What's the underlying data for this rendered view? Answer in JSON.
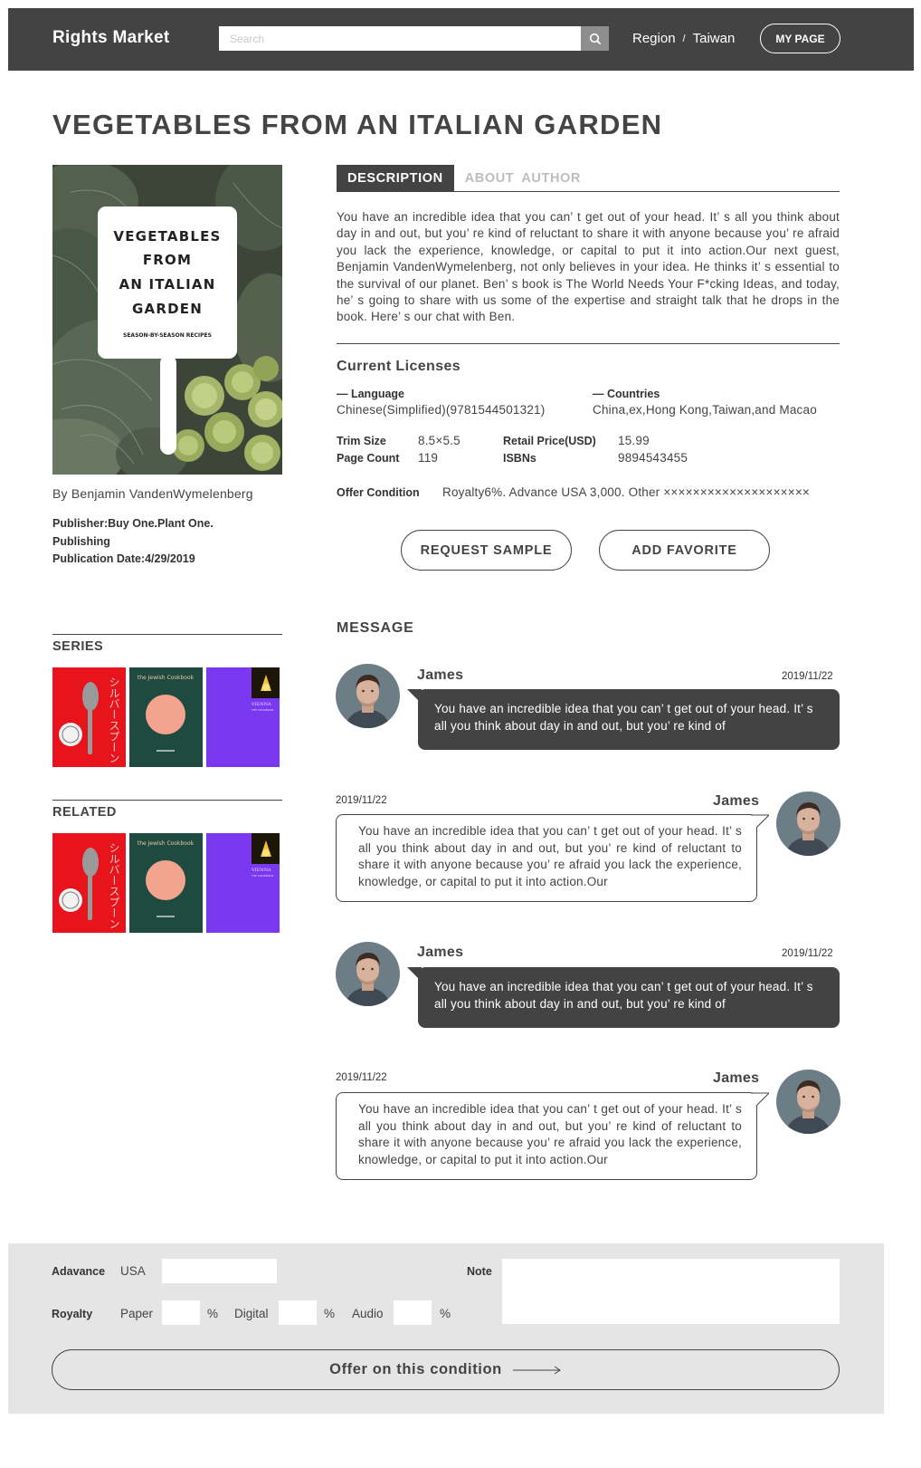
{
  "header": {
    "logo": "Rights Market",
    "search_placeholder": "Search",
    "region_label": "Region",
    "region_separator": "/",
    "region_value": "Taiwan",
    "mypage_label": "MY PAGE"
  },
  "book": {
    "title": "VEGETABLES FROM AN ITALIAN GARDEN",
    "cover": {
      "lines": [
        "VEGETABLES",
        "FROM",
        "AN ITALIAN",
        "GARDEN"
      ],
      "subtitle": "SEASON-BY-SEASON RECIPES"
    },
    "author": "By Benjamin VandenWymelenberg",
    "publisher_line1": "Publisher:Buy One.Plant One.",
    "publisher_line2": "Publishing",
    "pub_date": "Publication Date:4/29/2019"
  },
  "tabs": [
    {
      "label": "DESCRIPTION",
      "active": true
    },
    {
      "label": "ABOUT AUTHOR",
      "active": false
    }
  ],
  "description": "You have an incredible idea that you can’ t get out of your head. It’ s all you think about day in and out, but you’ re kind of reluctant to share it with anyone because you’ re afraid you lack the experience, knowledge, or capital to put it into action.Our next guest, Benjamin VandenWymelenberg, not only believes in your idea. He thinks it’ s essential to the survival of our planet. Ben’ s book is The World Needs Your F*cking Ideas, and today, he’ s going to share with us some of the expertise and straight talk that he drops in the book. Here’ s our chat with Ben.",
  "licenses": {
    "title": "Current Licenses",
    "language_label": "— Language",
    "language_value": "Chinese(Simplified)(9781544501321)",
    "countries_label": "— Countries",
    "countries_value": "China,ex,Hong Kong,Taiwan,and Macao",
    "trim_label": "Trim Size",
    "trim_value": "8.5×5.5",
    "retail_label": "Retail Price(USD)",
    "retail_value": "15.99",
    "pages_label": "Page Count",
    "pages_value": "119",
    "isbn_label": "ISBNs",
    "isbn_value": "9894543455",
    "offer_label": "Offer Condition",
    "offer_value": "Royalty6%. Advance USA 3,000. Other ××××××××××××××××××××"
  },
  "actions": {
    "request_sample": "REQUEST SAMPLE",
    "add_favorite": "ADD FAVORITE"
  },
  "sidebar": {
    "series_title": "SERIES",
    "related_title": "RELATED",
    "thumb_texts": {
      "jp_title": "シルバースプーン",
      "green_title": "the Jewish Cookbook",
      "purple_title": "VIENNA",
      "purple_sub": "THE COOKBOOK"
    }
  },
  "messages": {
    "title": "MESSAGE",
    "items": [
      {
        "name": "James",
        "date": "2019/11/22",
        "text": "You have an incredible idea that you can’ t get out of your head. It’ s all you think about day in and out, but you’ re kind of"
      },
      {
        "name": "James",
        "date": "2019/11/22",
        "text": "You have an incredible idea that you can’ t get out of your head. It’ s all you think about day in and out, but you’ re kind of reluctant to share it with anyone because you’ re afraid you lack the experience, knowledge, or capital to put it into action.Our"
      },
      {
        "name": "James",
        "date": "2019/11/22",
        "text": "You have an incredible idea that you can’ t get out of your head. It’ s all you think about day in and out, but you’ re kind of"
      },
      {
        "name": "James",
        "date": "2019/11/22",
        "text": "You have an incredible idea that you can’ t get out of your head. It’ s all you think about day in and out, but you’ re kind of reluctant to share it with anyone because you’ re afraid you lack the experience, knowledge, or capital to put it into action.Our"
      }
    ]
  },
  "form": {
    "advance_label": "Adavance",
    "advance_currency": "USA",
    "note_label": "Note",
    "royalty_label": "Royalty",
    "paper_label": "Paper",
    "digital_label": "Digital",
    "audio_label": "Audio",
    "percent": "%",
    "offer_button": "Offer on this condition"
  }
}
